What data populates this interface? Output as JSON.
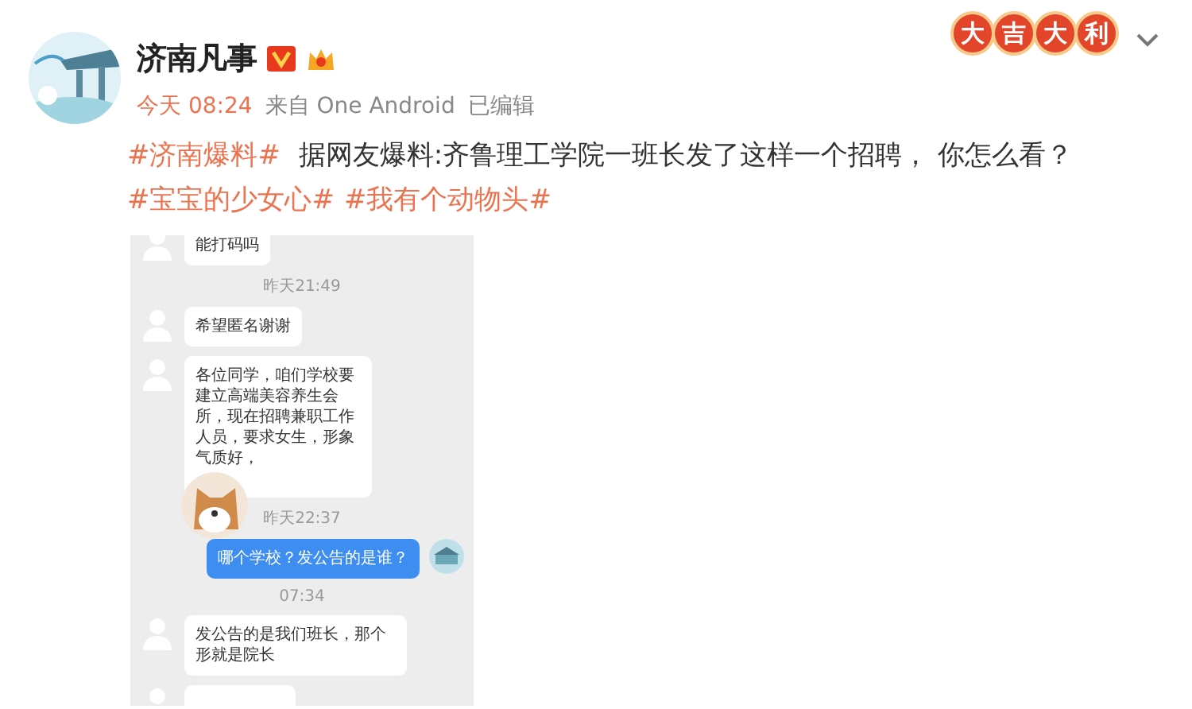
{
  "post": {
    "author": "济南凡事",
    "verified": true,
    "time": "今天 08:24",
    "source": "来自 One Android",
    "edited": "已编辑",
    "badge": [
      "大",
      "吉",
      "大",
      "利"
    ],
    "content": [
      {
        "kind": "tag",
        "text": "#济南爆料#"
      },
      {
        "kind": "text",
        "text": " 据网友爆料:齐鲁理工学院一班长发了这样一个招聘， 你怎么看？ "
      },
      {
        "kind": "tag",
        "text": "#宝宝的少女心#"
      },
      {
        "kind": "tag",
        "text": "#我有个动物头#"
      }
    ]
  },
  "chat": [
    {
      "kind": "in",
      "text": "能打码吗"
    },
    {
      "kind": "time",
      "text": "昨天21:49"
    },
    {
      "kind": "in",
      "text": "希望匿名谢谢"
    },
    {
      "kind": "notice",
      "text": "各位同学，咱们学校要建立高端美容养生会所，现在招聘兼职工作人员，要求女生，形象气质好，"
    },
    {
      "kind": "time",
      "text": "昨天22:37"
    },
    {
      "kind": "out",
      "text": "哪个学校？发公告的是谁？"
    },
    {
      "kind": "time",
      "text": "07:34"
    },
    {
      "kind": "in",
      "text": "发公告的是我们班长，那个形就是院长"
    },
    {
      "kind": "cut"
    }
  ]
}
